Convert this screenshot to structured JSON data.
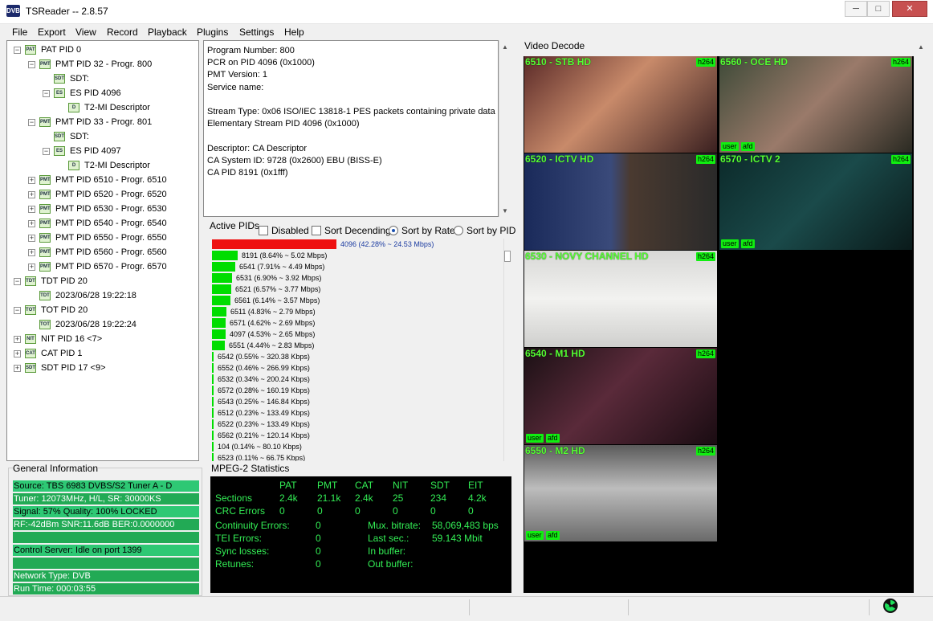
{
  "window": {
    "title": "TSReader -- 2.8.57",
    "icon_text": "DVB",
    "min": "─",
    "max": "□",
    "close": "✕"
  },
  "menu": [
    "File",
    "Export",
    "View",
    "Record",
    "Playback",
    "Plugins",
    "Settings",
    "Help"
  ],
  "tree": [
    {
      "depth": 0,
      "exp": "−",
      "icon": "PAT",
      "label": "PAT PID 0"
    },
    {
      "depth": 1,
      "exp": "−",
      "icon": "PMT",
      "label": "PMT PID 32 - Progr. 800"
    },
    {
      "depth": 2,
      "exp": "",
      "icon": "SDT",
      "label": "SDT:"
    },
    {
      "depth": 2,
      "exp": "−",
      "icon": "ES",
      "label": "ES PID 4096"
    },
    {
      "depth": 3,
      "exp": "",
      "icon": "D",
      "label": "T2-MI Descriptor"
    },
    {
      "depth": 1,
      "exp": "−",
      "icon": "PMT",
      "label": "PMT PID 33 - Progr. 801"
    },
    {
      "depth": 2,
      "exp": "",
      "icon": "SDT",
      "label": "SDT:"
    },
    {
      "depth": 2,
      "exp": "−",
      "icon": "ES",
      "label": "ES PID 4097"
    },
    {
      "depth": 3,
      "exp": "",
      "icon": "D",
      "label": "T2-MI Descriptor"
    },
    {
      "depth": 1,
      "exp": "+",
      "icon": "PMT",
      "label": "PMT PID 6510 - Progr. 6510"
    },
    {
      "depth": 1,
      "exp": "+",
      "icon": "PMT",
      "label": "PMT PID 6520 - Progr. 6520"
    },
    {
      "depth": 1,
      "exp": "+",
      "icon": "PMT",
      "label": "PMT PID 6530 - Progr. 6530"
    },
    {
      "depth": 1,
      "exp": "+",
      "icon": "PMT",
      "label": "PMT PID 6540 - Progr. 6540"
    },
    {
      "depth": 1,
      "exp": "+",
      "icon": "PMT",
      "label": "PMT PID 6550 - Progr. 6550"
    },
    {
      "depth": 1,
      "exp": "+",
      "icon": "PMT",
      "label": "PMT PID 6560 - Progr. 6560"
    },
    {
      "depth": 1,
      "exp": "+",
      "icon": "PMT",
      "label": "PMT PID 6570 - Progr. 6570"
    },
    {
      "depth": 0,
      "exp": "−",
      "icon": "TDT",
      "label": "TDT PID 20"
    },
    {
      "depth": 1,
      "exp": "",
      "icon": "TDT",
      "label": "2023/06/28 19:22:18"
    },
    {
      "depth": 0,
      "exp": "−",
      "icon": "TOT",
      "label": "TOT PID 20"
    },
    {
      "depth": 1,
      "exp": "",
      "icon": "TOT",
      "label": "2023/06/28 19:22:24"
    },
    {
      "depth": 0,
      "exp": "+",
      "icon": "NIT",
      "label": "NIT PID 16 <7>"
    },
    {
      "depth": 0,
      "exp": "+",
      "icon": "CAT",
      "label": "CAT PID 1"
    },
    {
      "depth": 0,
      "exp": "+",
      "icon": "SDT",
      "label": "SDT PID 17 <9>"
    }
  ],
  "info_lines": [
    "Program Number: 800",
    "PCR on PID 4096 (0x1000)",
    "PMT Version: 1",
    "Service name:",
    "",
    "Stream Type: 0x06 ISO/IEC 13818-1 PES packets containing private data",
    " Elementary Stream PID 4096 (0x1000)",
    "",
    "Descriptor: CA Descriptor",
    " CA System ID: 9728 (0x2600) EBU (BISS-E)",
    " CA PID 8191 (0x1fff)"
  ],
  "active_pids": {
    "title": "Active PIDs",
    "disabled_label": "Disabled",
    "sort_desc_label": "Sort Decending",
    "sort_rate_label": "Sort by Rate",
    "sort_pid_label": "Sort by PID",
    "disabled": false,
    "sort_desc": false,
    "sort_mode": "rate",
    "rows": [
      {
        "pct": 42.28,
        "text": "4096 (42.28% ~ 24.53 Mbps)",
        "color": "#ee1111",
        "text_color": "#1a3aa0"
      },
      {
        "pct": 8.64,
        "text": "8191 (8.64% ~ 5.02 Mbps)",
        "color": "#00dd00",
        "text_color": "#000000"
      },
      {
        "pct": 7.91,
        "text": "6541 (7.91% ~ 4.49 Mbps)",
        "color": "#00dd00",
        "text_color": "#000000"
      },
      {
        "pct": 6.9,
        "text": "6531 (6.90% ~ 3.92 Mbps)",
        "color": "#00dd00",
        "text_color": "#000000"
      },
      {
        "pct": 6.57,
        "text": "6521 (6.57% ~ 3.77 Mbps)",
        "color": "#00dd00",
        "text_color": "#000000"
      },
      {
        "pct": 6.14,
        "text": "6561 (6.14% ~ 3.57 Mbps)",
        "color": "#00dd00",
        "text_color": "#000000"
      },
      {
        "pct": 4.83,
        "text": "6511 (4.83% ~ 2.79 Mbps)",
        "color": "#00dd00",
        "text_color": "#000000"
      },
      {
        "pct": 4.62,
        "text": "6571 (4.62% ~ 2.69 Mbps)",
        "color": "#00dd00",
        "text_color": "#000000"
      },
      {
        "pct": 4.53,
        "text": "4097 (4.53% ~ 2.65 Mbps)",
        "color": "#00dd00",
        "text_color": "#000000"
      },
      {
        "pct": 4.44,
        "text": "6551 (4.44% ~ 2.83 Mbps)",
        "color": "#00dd00",
        "text_color": "#000000"
      },
      {
        "pct": 0.55,
        "text": "6542 (0.55% ~ 320.38 Kbps)",
        "color": "#00dd00",
        "text_color": "#000000"
      },
      {
        "pct": 0.46,
        "text": "6552 (0.46% ~ 266.99 Kbps)",
        "color": "#00dd00",
        "text_color": "#000000"
      },
      {
        "pct": 0.34,
        "text": "6532 (0.34% ~ 200.24 Kbps)",
        "color": "#00dd00",
        "text_color": "#000000"
      },
      {
        "pct": 0.28,
        "text": "6572 (0.28% ~ 160.19 Kbps)",
        "color": "#00dd00",
        "text_color": "#000000"
      },
      {
        "pct": 0.25,
        "text": "6543 (0.25% ~ 146.84 Kbps)",
        "color": "#00dd00",
        "text_color": "#000000"
      },
      {
        "pct": 0.23,
        "text": "6512 (0.23% ~ 133.49 Kbps)",
        "color": "#00dd00",
        "text_color": "#000000"
      },
      {
        "pct": 0.23,
        "text": "6522 (0.23% ~ 133.49 Kbps)",
        "color": "#00dd00",
        "text_color": "#000000"
      },
      {
        "pct": 0.21,
        "text": "6562 (0.21% ~ 120.14 Kbps)",
        "color": "#00dd00",
        "text_color": "#000000"
      },
      {
        "pct": 0.14,
        "text": "104 (0.14% ~ 80.10 Kbps)",
        "color": "#00dd00",
        "text_color": "#000000"
      },
      {
        "pct": 0.11,
        "text": "6523 (0.11% ~ 66.75 Kbps)",
        "color": "#00dd00",
        "text_color": "#000000"
      }
    ]
  },
  "general": {
    "title": "General Information",
    "rows": [
      {
        "text": "Source: TBS 6983 DVBS/S2 Tuner A - D",
        "style": "g1"
      },
      {
        "text": "Tuner: 12073MHz, H/L, SR: 30000KS",
        "style": "g2"
      },
      {
        "text": "Signal: 57% Quality: 100% LOCKED",
        "style": "g1"
      },
      {
        "text": "RF:-42dBm SNR:11.6dB BER:0.0000000",
        "style": "g2"
      },
      {
        "text": "",
        "style": "g2"
      },
      {
        "text": "Control Server: Idle on port 1399",
        "style": "g1"
      },
      {
        "text": "",
        "style": "g2"
      },
      {
        "text": "Network Type: DVB",
        "style": "g2"
      },
      {
        "text": "Run Time: 000:03:55",
        "style": "g2"
      }
    ]
  },
  "mpeg2": {
    "title": "MPEG-2 Statistics",
    "columns": [
      "PAT",
      "PMT",
      "CAT",
      "NIT",
      "SDT",
      "EIT"
    ],
    "sections_label": "Sections",
    "sections": [
      "2.4k",
      "21.1k",
      "2.4k",
      "25",
      "234",
      "4.2k"
    ],
    "crc_label": "CRC Errors",
    "crc": [
      "0",
      "0",
      "0",
      "0",
      "0",
      "0"
    ],
    "continuity_label": "Continuity Errors:",
    "continuity": "0",
    "tei_label": "TEI Errors:",
    "tei": "0",
    "sync_label": "Sync losses:",
    "sync": "0",
    "retunes_label": "Retunes:",
    "retunes": "0",
    "mux_label": "Mux. bitrate:",
    "mux": "58,069,483 bps",
    "last_label": "Last sec.:",
    "last": "59.143 Mbit",
    "inbuf_label": "In buffer:",
    "outbuf_label": "Out buffer:"
  },
  "video": {
    "title": "Video Decode",
    "tiles": [
      {
        "name": "6510 - STB HD",
        "codec": "h264",
        "flags": []
      },
      {
        "name": "6560 - OCE HD",
        "codec": "h264",
        "flags": [
          "user",
          "afd"
        ]
      },
      {
        "name": "6520 - ICTV HD",
        "codec": "h264",
        "flags": []
      },
      {
        "name": "6570 - ICTV 2",
        "codec": "h264",
        "flags": [
          "user",
          "afd"
        ]
      },
      {
        "name": "6530 - NOVY CHANNEL HD",
        "codec": "h264",
        "flags": []
      },
      {
        "name": "6540 - M1 HD",
        "codec": "h264",
        "flags": [
          "user",
          "afd"
        ]
      },
      {
        "name": "6550 - M2 HD",
        "codec": "h264",
        "flags": [
          "user",
          "afd"
        ]
      }
    ]
  }
}
